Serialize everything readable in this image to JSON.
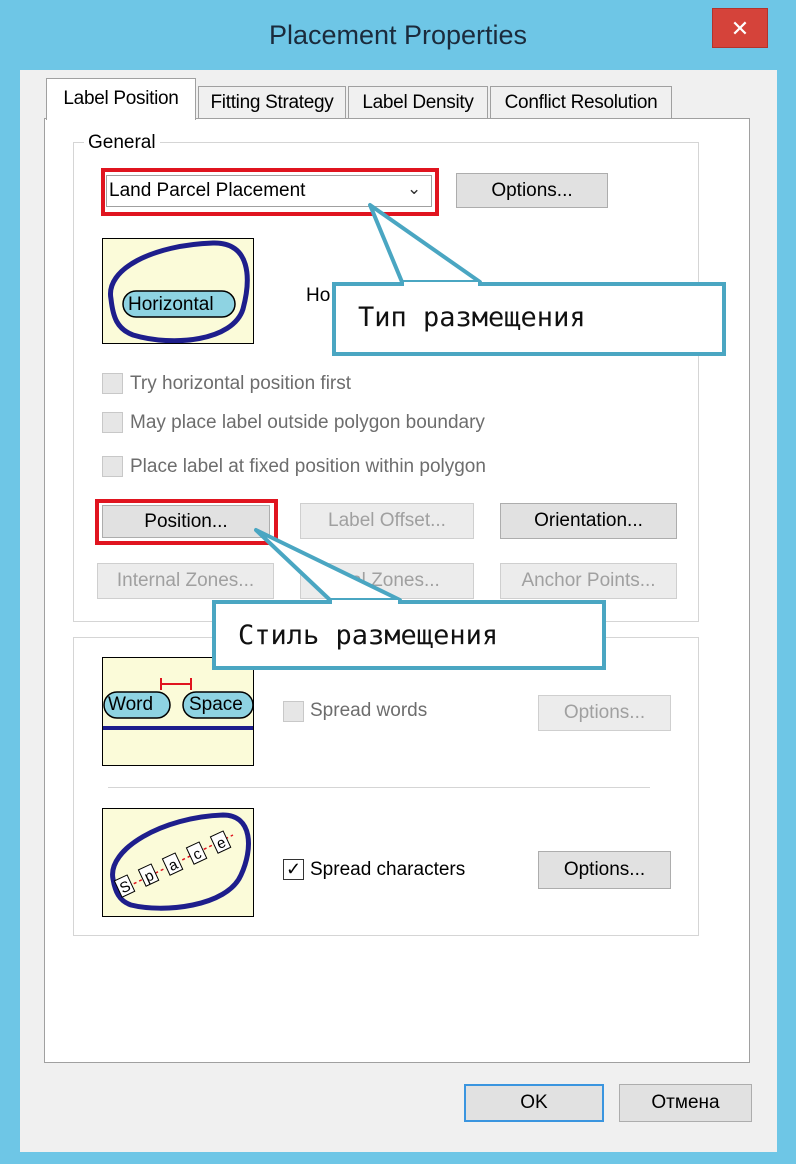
{
  "window": {
    "title": "Placement Properties",
    "close_glyph": "✕"
  },
  "tabs": [
    {
      "label": "Label Position",
      "active": true
    },
    {
      "label": "Fitting Strategy",
      "active": false
    },
    {
      "label": "Label Density",
      "active": false
    },
    {
      "label": "Conflict Resolution",
      "active": false
    }
  ],
  "general": {
    "title": "General",
    "placement_select": {
      "value": "Land Parcel Placement"
    },
    "options_button": "Options...",
    "thumbnail_label": "Horizontal",
    "mode_text": "Ho",
    "checkboxes": [
      {
        "label": "Try horizontal position first",
        "checked": false,
        "enabled": false
      },
      {
        "label": "May place label outside polygon boundary",
        "checked": false,
        "enabled": false
      },
      {
        "label": "Place label at fixed position within polygon",
        "checked": false,
        "enabled": false
      }
    ],
    "buttons_row1": [
      "Position...",
      "Label Offset...",
      "Orientation..."
    ],
    "buttons_row2": [
      "Internal Zones...",
      "External Zones...",
      "Anchor Points..."
    ],
    "buttons_row2_visible": [
      "Internal Zones...",
      "rnal Zones...",
      "Anchor Points..."
    ]
  },
  "spread": {
    "word_thumb": {
      "word1": "Word",
      "word2": "Space"
    },
    "spread_words": {
      "label": "Spread words",
      "checked": false,
      "enabled": false
    },
    "spread_words_options": "Options...",
    "char_thumb_letters": [
      "S",
      "p",
      "a",
      "c",
      "e"
    ],
    "spread_chars": {
      "label": "Spread characters",
      "checked": true,
      "enabled": true
    },
    "spread_chars_options": "Options..."
  },
  "footer": {
    "ok": "OK",
    "cancel": "Отмена"
  },
  "annotations": {
    "callout1": "Тип размещения",
    "callout2": "Стиль размещения"
  },
  "colors": {
    "title_bar": "#6ec6e6",
    "close_button": "#d5433a",
    "highlight_red": "#e0141f",
    "callout_border": "#4aa6c2",
    "thumbnail_bg": "#fbfbd9",
    "polygon_stroke": "#1e1e8c",
    "label_fill": "#8ed3e2"
  }
}
